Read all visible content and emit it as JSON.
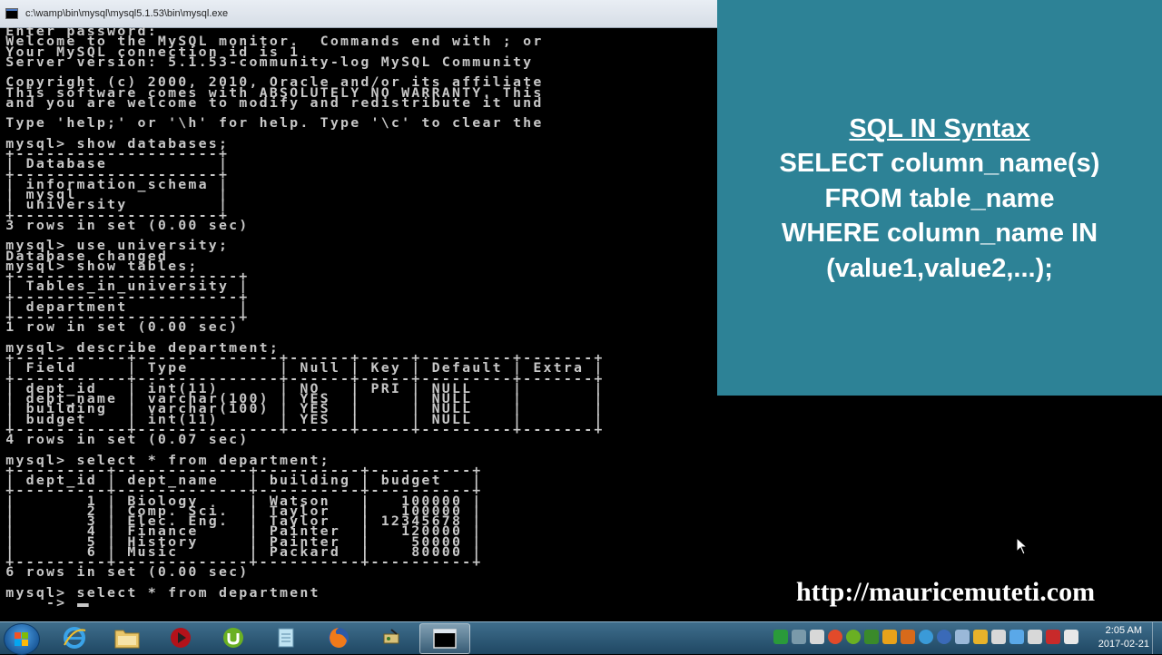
{
  "window": {
    "title": "c:\\wamp\\bin\\mysql\\mysql5.1.53\\bin\\mysql.exe"
  },
  "console": {
    "text": "Enter password:\nWelcome to the MySQL monitor.  Commands end with ; or\nYour MySQL connection id is 1\nServer version: 5.1.53-community-log MySQL Community\n\nCopyright (c) 2000, 2010, Oracle and/or its affiliate\nThis software comes with ABSOLUTELY NO WARRANTY. This\nand you are welcome to modify and redistribute it und\n\nType 'help;' or '\\h' for help. Type '\\c' to clear the\n\nmysql> show databases;\n+--------------------+\n| Database           |\n+--------------------+\n| information_schema |\n| mysql              |\n| university         |\n+--------------------+\n3 rows in set (0.00 sec)\n\nmysql> use university;\nDatabase changed\nmysql> show tables;\n+----------------------+\n| Tables_in_university |\n+----------------------+\n| department           |\n+----------------------+\n1 row in set (0.00 sec)\n\nmysql> describe department;\n+-----------+--------------+------+-----+---------+-------+\n| Field     | Type         | Null | Key | Default | Extra |\n+-----------+--------------+------+-----+---------+-------+\n| dept_id   | int(11)      | NO   | PRI | NULL    |       |\n| dept_name | varchar(100) | YES  |     | NULL    |       |\n| building  | varchar(100) | YES  |     | NULL    |       |\n| budget    | int(11)      | YES  |     | NULL    |       |\n+-----------+--------------+------+-----+---------+-------+\n4 rows in set (0.07 sec)\n\nmysql> select * from department;\n+---------+-------------+----------+----------+\n| dept_id | dept_name   | building | budget   |\n+---------+-------------+----------+----------+\n|       1 | Biology     | Watson   |   100000 |\n|       2 | Comp. Sci.  | Taylor   |   100000 |\n|       3 | Elec. Eng.  | Taylor   | 12345678 |\n|       4 | Finance     | Painter  |   120000 |\n|       5 | History     | Painter  |    50000 |\n|       6 | Music       | Packard  |    80000 |\n+---------+-------------+----------+----------+\n6 rows in set (0.00 sec)\n\nmysql> select * from department\n    -> "
  },
  "syntax_panel": {
    "title": "SQL IN Syntax",
    "lines": [
      "SELECT column_name(s)",
      "FROM table_name",
      "WHERE column_name IN",
      "(value1,value2,...);"
    ]
  },
  "watermark": {
    "url": "http://mauricemuteti.com"
  },
  "taskbar": {
    "clock_time": "2:05 AM",
    "clock_date": "2017-02-21",
    "apps": [
      "start",
      "internet-explorer",
      "file-explorer",
      "media-player",
      "utorrent",
      "notepad",
      "firefox",
      "network-tool",
      "mysql-console"
    ]
  },
  "colors": {
    "panel_bg": "#2d8296",
    "console_text": "#c8c8c8",
    "taskbar": "#2a5a7a"
  }
}
